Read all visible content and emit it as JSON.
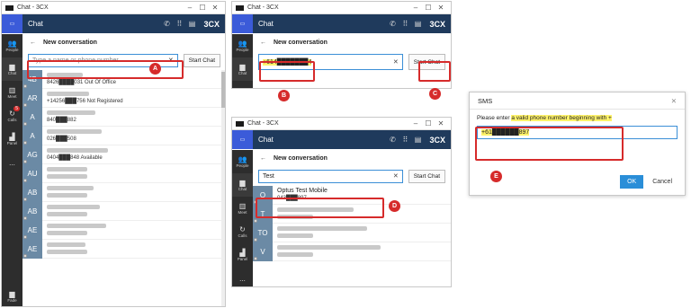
{
  "window_a": {
    "title": "Chat - 3CX",
    "app_title": "Chat",
    "brand": "3CX",
    "nav": [
      {
        "label": "People",
        "icon": "people-icon"
      },
      {
        "label": "Chat",
        "icon": "chat-icon"
      },
      {
        "label": "Meet",
        "icon": "meet-icon"
      },
      {
        "label": "Calls",
        "icon": "calls-icon",
        "badge": "5"
      },
      {
        "label": "Panel",
        "icon": "panel-icon"
      },
      {
        "label": "...",
        "icon": "more-icon"
      },
      {
        "label": "Fade",
        "icon": "fade-icon"
      }
    ],
    "header": "New conversation",
    "search_placeholder": "Type a name or phone number",
    "start_chat": "Start Chat",
    "contacts": [
      {
        "initials": "4B",
        "line2": "8426████031 Out Of Office"
      },
      {
        "initials": "AR",
        "line2": "+14256███756 Not Registered"
      },
      {
        "initials": "A",
        "line2": "840███882"
      },
      {
        "initials": "A",
        "line2": "026███508"
      },
      {
        "initials": "AG",
        "line2": "0404███848 Available"
      },
      {
        "initials": "AU",
        "line2": ""
      },
      {
        "initials": "AB",
        "line2": ""
      },
      {
        "initials": "AB",
        "line2": ""
      },
      {
        "initials": "AE",
        "line2": ""
      },
      {
        "initials": "AE",
        "line2": ""
      }
    ]
  },
  "window_b": {
    "title": "Chat - 3CX",
    "app_title": "Chat",
    "header": "New conversation",
    "input_value": "+614███████4",
    "start_chat": "Start Chat"
  },
  "window_c": {
    "title": "Chat - 3CX",
    "app_title": "Chat",
    "header": "New conversation",
    "input_value": "Test",
    "start_chat": "Start Chat",
    "results": [
      {
        "initials": "O",
        "line1": "Optus Test Mobile",
        "line2": "043███897"
      },
      {
        "initials": "T",
        "line1": "",
        "line2": ""
      },
      {
        "initials": "TO",
        "line1": "",
        "line2": ""
      },
      {
        "initials": "V",
        "line1": "",
        "line2": ""
      }
    ]
  },
  "sms_dialog": {
    "title": "SMS",
    "message_prefix": "Please enter ",
    "message_highlight": "a valid phone number beginning with +",
    "input_value": "+61██████897",
    "ok": "OK",
    "cancel": "Cancel"
  },
  "callouts": [
    "A",
    "B",
    "C",
    "D",
    "E"
  ],
  "colors": {
    "accent": "#3b5bd9",
    "appbar": "#1f3a5c",
    "callout": "#d62b2b",
    "highlight": "#fff36b"
  }
}
